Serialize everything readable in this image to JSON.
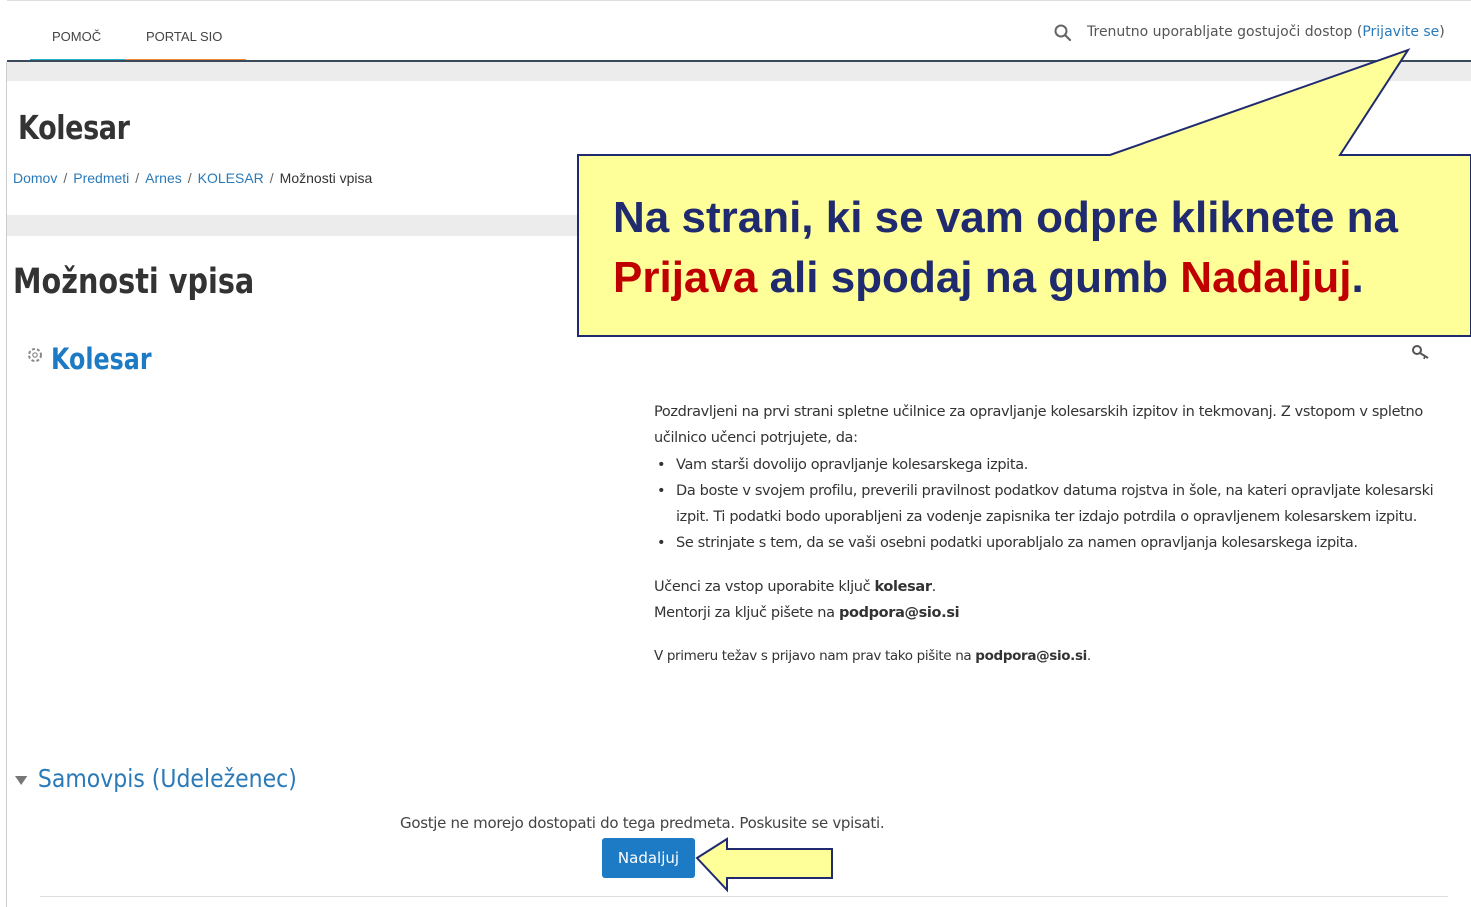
{
  "nav": {
    "items": [
      {
        "label": "POMOČ",
        "color": "#27b2c9"
      },
      {
        "label": "PORTAL SIO",
        "color": "#f28b30"
      }
    ],
    "login_prefix": "Trenutno uporabljate gostujoči dostop (",
    "login_link": "Prijavite se",
    "login_suffix": ")"
  },
  "page": {
    "title": "Kolesar",
    "breadcrumb": [
      "Domov",
      "Predmeti",
      "Arnes",
      "KOLESAR",
      "Možnosti vpisa"
    ]
  },
  "main": {
    "heading": "Možnosti vpisa",
    "course_name": "Kolesar",
    "summary": {
      "intro": "Pozdravljeni na prvi strani spletne učilnice za opravljanje kolesarskih izpitov in tekmovanj. Z vstopom v spletno učilnico učenci potrjujete, da:",
      "bullets": [
        "Vam starši dovolijo opravljanje kolesarskega izpita.",
        "Da boste v svojem profilu, preverili pravilnost podatkov datuma rojstva in šole, na kateri opravljate kolesarski izpit. Ti podatki bodo uporabljeni za vodenje zapisnika ter izdajo potrdila o opravljenem kolesarskem izpitu.",
        "Se strinjate s tem, da se vaši osebni podatki uporabljalo za namen opravljanja kolesarskega izpita."
      ],
      "key_prefix": "Učenci za vstop uporabite ključ ",
      "key_value": "kolesar",
      "key_suffix": ".",
      "mentor_prefix": "Mentorji za ključ pišete na ",
      "mentor_email": "podpora@sio.si",
      "help_prefix": "V primeru težav s prijavo nam prav tako pišite na ",
      "help_email": "podpora@sio.si",
      "help_suffix": "."
    },
    "self_enrol": {
      "header": "Samovpis (Udeleženec)",
      "guest_message": "Gostje ne morejo dostopati do tega predmeta. Poskusite se vpisati.",
      "button": "Nadaljuj"
    }
  },
  "annotation": {
    "line1": "Na strani, ki se vam odpre kliknete na",
    "line2_highlight1": "Prijava",
    "line2_mid": " ali spodaj na gumb ",
    "line2_highlight2": "Nadaljuj",
    "line2_end": ".",
    "fill_color": "#ffff99",
    "text_color": "#1f2b6e",
    "highlight_color": "#c00000"
  }
}
